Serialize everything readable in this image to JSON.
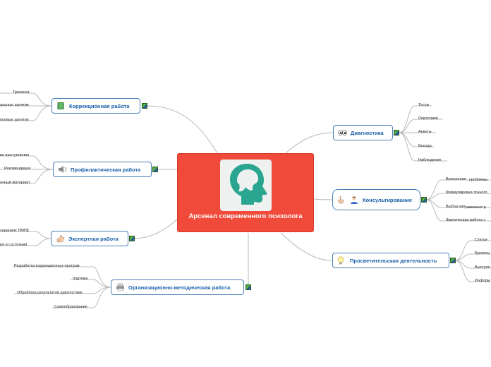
{
  "root": {
    "title": "Арсенал современного психолога",
    "icon": "head-silhouette-icon"
  },
  "branches": {
    "correction": {
      "label": "Коррекционная работа",
      "icon": "book-icon",
      "items": [
        "Тренинги",
        "альные занятие",
        "пповые занятия"
      ]
    },
    "prevention": {
      "label": "Профилактическая работа",
      "icon": "speaker-icon",
      "items": [
        "ие выступления",
        "Рекомендации",
        "очный материал"
      ]
    },
    "expert": {
      "label": "Экспертная работа",
      "icon": "thumbs-up-icon",
      "items": [
        "седаниях ПМПК",
        "ия и состояния"
      ]
    },
    "method": {
      "label": "Организационно-методическая работа",
      "icon": "printer-icon",
      "items": [
        "Разработка коррекционных програм",
        "подтема",
        "Обработка результатов диагностики",
        "Самообразование"
      ]
    },
    "diagnostics": {
      "label": "Диагностика",
      "icon": "eyes-icon",
      "items": [
        "Тесты",
        "Опросники",
        "Анкеты",
        "Беседа",
        "Наблюдение"
      ]
    },
    "consulting": {
      "label": "Консультирование",
      "icon": "person-icon",
      "items": [
        "Выяснения",
        "проблемы",
        "Формулировка точного",
        "Выбор нап",
        "равления р",
        "Фактическая работа с"
      ]
    },
    "education": {
      "label": "Просветительская деятельность",
      "icon": "lightbulb-icon",
      "items": [
        "Статьи",
        "Буклеты",
        "Выступл",
        "Информ"
      ]
    }
  },
  "colors": {
    "root": "#f04a3a",
    "node_border": "#4a7fb8",
    "node_text": "#1a5fa8",
    "connector": "#b8b8b8"
  }
}
